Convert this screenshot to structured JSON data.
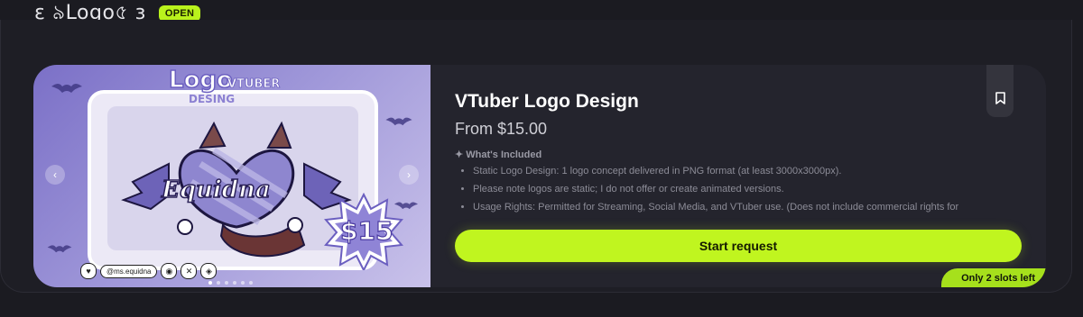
{
  "header": {
    "brand": "ε ৯Logo৫ з",
    "status": "OPEN"
  },
  "hero": {
    "logo_word": "Logo",
    "vtuber_word": "VTUBER",
    "desing_word": "DESING",
    "character_name": "Equidna",
    "price_badge": "$15",
    "social_handle": "@ms.equidna",
    "prev_arrow": "‹",
    "next_arrow": "›",
    "slides_total": 6,
    "active_slide": 1
  },
  "product": {
    "title": "VTuber Logo Design",
    "price": "From $15.00",
    "included_heading": "✦ What's Included",
    "features": [
      "Static Logo Design: 1 logo concept delivered in PNG format (at least 3000x3000px).",
      "Please note logos are static; I do not offer or create animated versions.",
      "Usage Rights: Permitted for Streaming, Social Media, and VTuber use. (Does not include commercial rights for merchandise/physical products)."
    ],
    "cta": "Start request",
    "slots": "Only 2 slots left"
  },
  "colors": {
    "accent": "#c0f51f",
    "background": "#1b1b21",
    "card": "#24242d"
  },
  "icons": [
    "bookmark-icon",
    "chevron-left-icon",
    "chevron-right-icon",
    "heart-icon",
    "discord-icon",
    "x-icon",
    "vtuber-icon"
  ]
}
